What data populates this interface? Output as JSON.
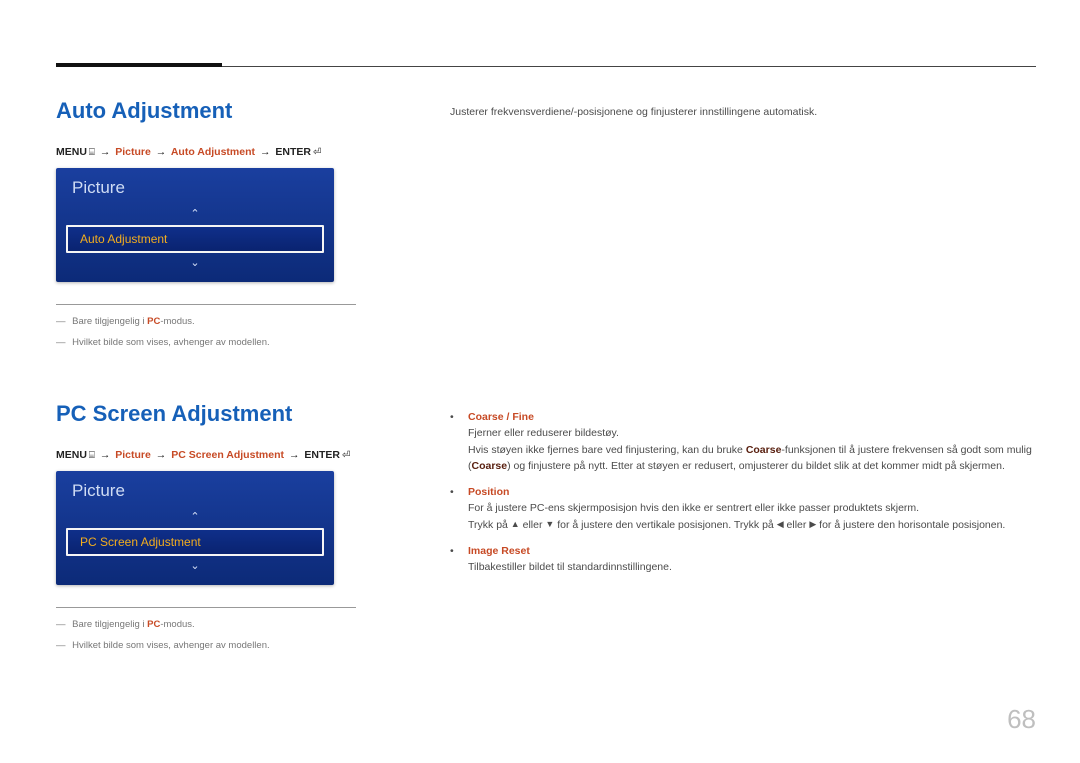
{
  "page_number": "68",
  "section1": {
    "heading": "Auto Adjustment",
    "path": {
      "menu": "MENU",
      "menu_icon": "⌸",
      "seg1": "Picture",
      "seg2": "Auto Adjustment",
      "enter": "ENTER",
      "enter_icon": "⏎"
    },
    "osd": {
      "title": "Picture",
      "selected": "Auto Adjustment"
    },
    "footnote1_pre": "Bare tilgjengelig i ",
    "footnote1_acc": "PC",
    "footnote1_post": "-modus.",
    "footnote2": "Hvilket bilde som vises, avhenger av modellen.",
    "right_para": "Justerer frekvensverdiene/-posisjonene og finjusterer innstillingene automatisk."
  },
  "section2": {
    "heading": "PC Screen Adjustment",
    "path": {
      "menu": "MENU",
      "menu_icon": "⌸",
      "seg1": "Picture",
      "seg2": "PC Screen Adjustment",
      "enter": "ENTER",
      "enter_icon": "⏎"
    },
    "osd": {
      "title": "Picture",
      "selected": "PC Screen Adjustment"
    },
    "footnote1_pre": "Bare tilgjengelig i ",
    "footnote1_acc": "PC",
    "footnote1_post": "-modus.",
    "footnote2": "Hvilket bilde som vises, avhenger av modellen.",
    "bullets": {
      "b1": {
        "label": "Coarse / Fine",
        "line1": "Fjerner eller reduserer bildestøy.",
        "line2a": "Hvis støyen ikke fjernes bare ved finjustering, kan du bruke ",
        "line2b": "Coarse",
        "line2c": "-funksjonen til å justere frekvensen så godt som mulig (",
        "line2d": "Coarse",
        "line2e": ") og finjustere på nytt. Etter at støyen er redusert, omjusterer du bildet slik at det kommer midt på skjermen."
      },
      "b2": {
        "label": "Position",
        "line1": "For å justere PC-ens skjermposisjon hvis den ikke er sentrert eller ikke passer produktets skjerm.",
        "line2a": "Trykk på ",
        "line2b": " eller ",
        "line2c": " for å justere den vertikale posisjonen. Trykk på ",
        "line2d": " eller ",
        "line2e": " for å justere den horisontale posisjonen."
      },
      "b3": {
        "label": "Image Reset",
        "line1": "Tilbakestiller bildet til standardinnstillingene."
      }
    }
  }
}
